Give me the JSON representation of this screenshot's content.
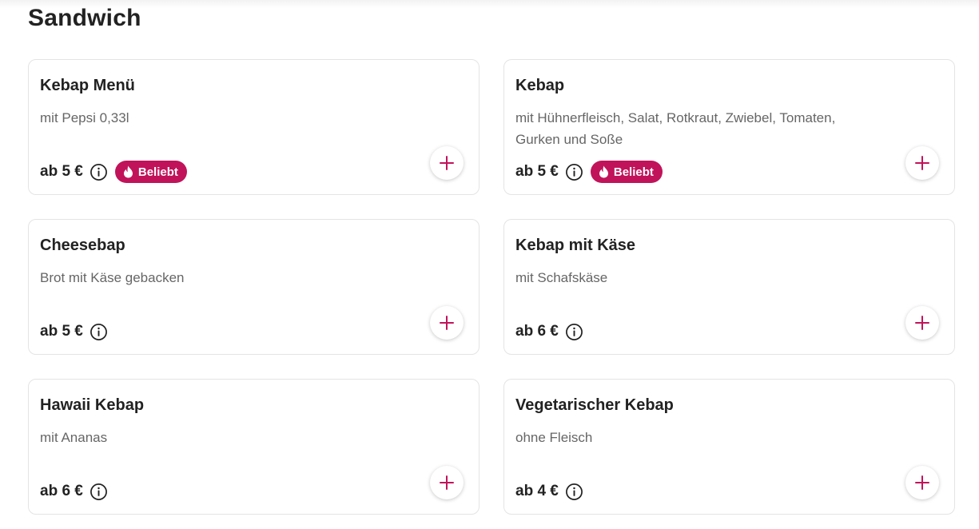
{
  "section": {
    "title": "Sandwich"
  },
  "colors": {
    "accent": "#c1135a",
    "text": "#222222",
    "muted": "#666666",
    "border": "#e4e4e4"
  },
  "icons": {
    "info": "info-circle-icon",
    "add": "plus-icon",
    "popular": "flame-icon"
  },
  "products": [
    {
      "name": "Kebap Menü",
      "description": "mit Pepsi 0,33l",
      "price": "ab 5 €",
      "badge": "Beliebt"
    },
    {
      "name": "Kebap",
      "description": "mit Hühnerfleisch, Salat, Rotkraut, Zwiebel, Tomaten, Gurken und Soße",
      "price": "ab 5 €",
      "badge": "Beliebt"
    },
    {
      "name": "Cheesebap",
      "description": "Brot mit Käse gebacken",
      "price": "ab 5 €"
    },
    {
      "name": "Kebap mit Käse",
      "description": "mit Schafskäse",
      "price": "ab 6 €"
    },
    {
      "name": "Hawaii Kebap",
      "description": "mit Ananas",
      "price": "ab 6 €"
    },
    {
      "name": "Vegetarischer Kebap",
      "description": "ohne Fleisch",
      "price": "ab 4 €"
    }
  ]
}
